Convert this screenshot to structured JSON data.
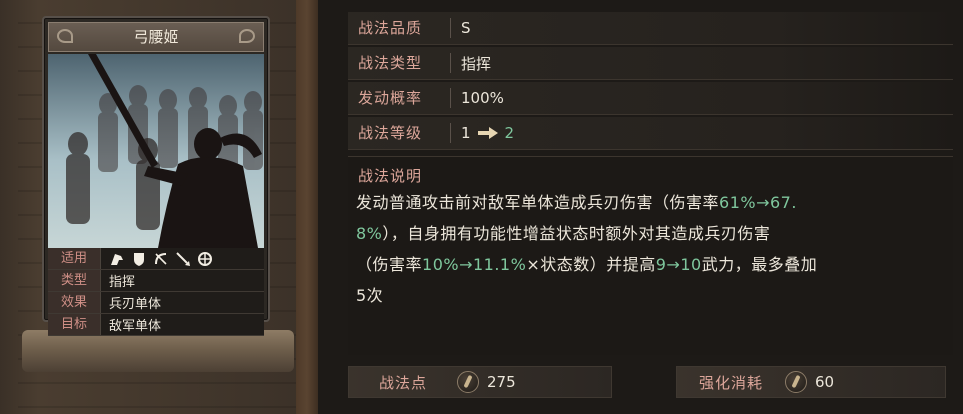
{
  "card": {
    "name": "弓腰姬",
    "attributes": [
      {
        "label": "适用",
        "icons": [
          "cavalry-icon",
          "shield-infantry-icon",
          "bow-archer-icon",
          "spear-icon",
          "wheel-siege-icon"
        ]
      },
      {
        "label": "类型",
        "value": "指挥"
      },
      {
        "label": "效果",
        "value": "兵刃单体"
      },
      {
        "label": "目标",
        "value": "敌军单体"
      }
    ]
  },
  "info": {
    "quality": {
      "label": "战法品质",
      "value": "S"
    },
    "type": {
      "label": "战法类型",
      "value": "指挥"
    },
    "rate": {
      "label": "发动概率",
      "value": "100%"
    },
    "level": {
      "label": "战法等级",
      "from": "1",
      "to": "2"
    }
  },
  "description": {
    "title": "战法说明",
    "lines": [
      [
        {
          "t": "发动普通攻击前对敌军单体造成兵刃伤害（伤害率"
        },
        {
          "t": "61%→67.",
          "g": true
        }
      ],
      [
        {
          "t": "8%",
          "g": true
        },
        {
          "t": "），自身拥有功能性增益状态时额外对其造成兵刃伤害"
        }
      ],
      [
        {
          "t": "（伤害率"
        },
        {
          "t": "10%→11.1%",
          "g": true
        },
        {
          "t": "×状态数）并提高"
        },
        {
          "t": "9→10",
          "g": true
        },
        {
          "t": "武力，最多叠加"
        }
      ],
      [
        {
          "t": "5次"
        }
      ]
    ]
  },
  "costs": {
    "points": {
      "label": "战法点",
      "value": "275"
    },
    "upgrade": {
      "label": "强化消耗",
      "value": "60"
    }
  },
  "colors": {
    "highlight": "#7fc79d",
    "label": "#dca69a",
    "attr_label": "#cf8f86"
  }
}
